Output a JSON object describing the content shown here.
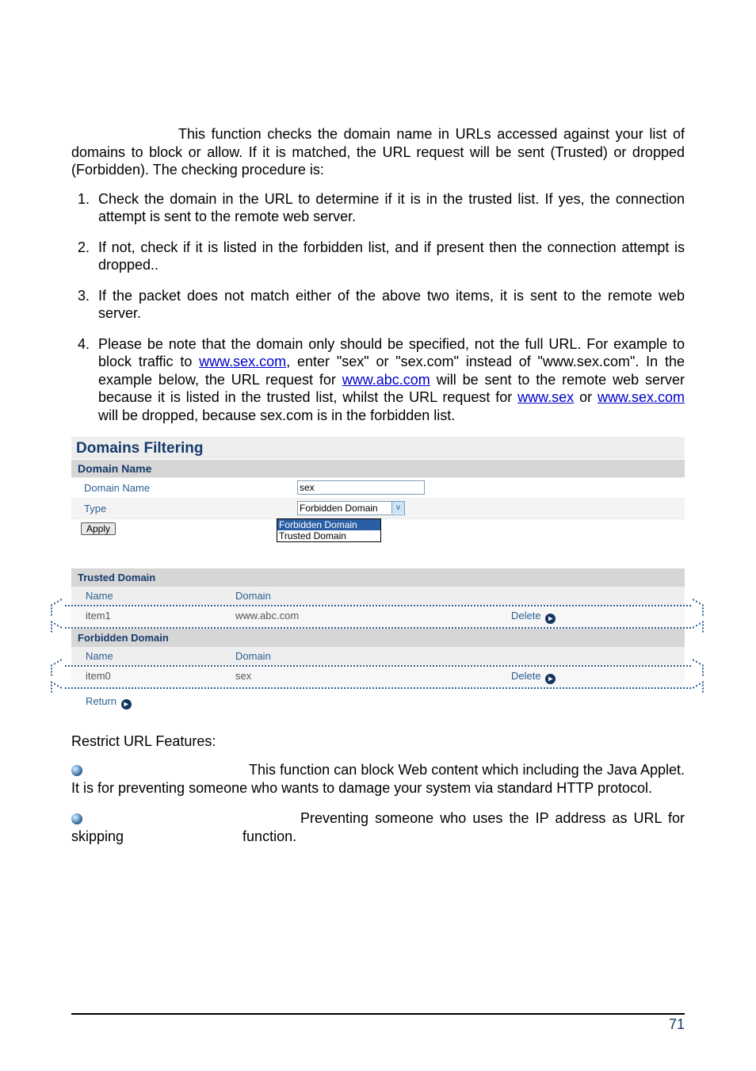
{
  "intro": "This function checks the domain name in URLs accessed against your list of domains to block or allow. If it is matched, the URL request will be sent (Trusted) or dropped (Forbidden). The checking procedure is:",
  "list": {
    "i1": "Check the domain in the URL to determine if it is in the trusted list. If yes, the connection attempt is sent to the remote web server.",
    "i2": "If not, check if it is listed in the forbidden list, and if present then the connection attempt is dropped..",
    "i3": "If the packet does not match either of the above two items, it is sent to the remote web server.",
    "i4_a": "Please be note that the domain only should be specified, not the full URL. For example to block traffic to ",
    "i4_link1": "www.sex.com",
    "i4_b": ", enter \"sex\" or \"sex.com\" instead of \"www.sex.com\". In the example below, the URL request for ",
    "i4_link2": "www.abc.com",
    "i4_c": " will be sent to the remote web server because it is listed in the trusted list, whilst the URL request for ",
    "i4_link3": "www.sex",
    "i4_d": " or ",
    "i4_link4": "www.sex.com",
    "i4_e": " will be dropped, because sex.com is in the forbidden list."
  },
  "panel": {
    "title": "Domains Filtering",
    "section": "Domain Name",
    "row_domain_label": "Domain Name",
    "domain_value": "sex",
    "row_type_label": "Type",
    "type_selected": "Forbidden Domain",
    "opt1": "Forbidden Domain",
    "opt2": "Trusted Domain",
    "apply": "Apply"
  },
  "dt": {
    "trusted_head": "Trusted Domain",
    "col_name": "Name",
    "col_domain": "Domain",
    "t_row_name": "item1",
    "t_row_domain": "www.abc.com",
    "delete": "Delete",
    "forbidden_head": "Forbidden Domain",
    "f_row_name": "item0",
    "f_row_domain": "sex",
    "return": "Return"
  },
  "restrict": {
    "heading": "Restrict URL Features:",
    "blk1": "This function can block Web content which including the Java Applet. It is for preventing someone who wants to damage your system via standard HTTP protocol.",
    "blk2a": "Preventing someone who uses the IP address as URL for skipping",
    "blk2b": "function."
  },
  "page_number": "71"
}
